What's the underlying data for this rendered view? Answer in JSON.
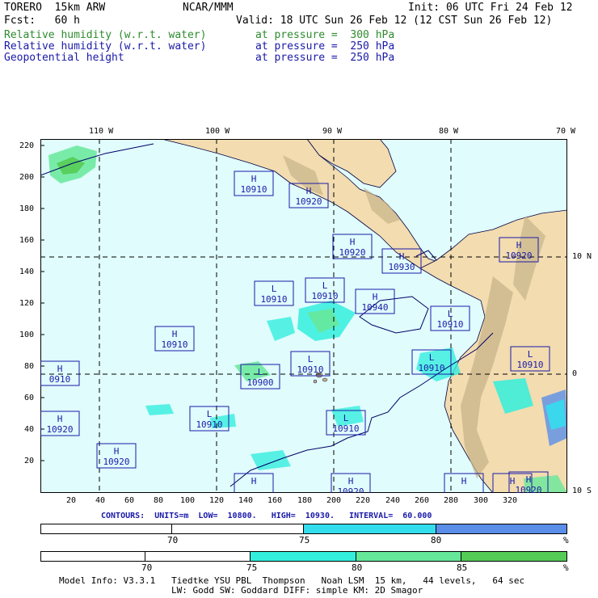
{
  "header": {
    "model": "TORERO  15km ARW",
    "org": "NCAR/MMM",
    "init": "Init: 06 UTC Fri 24 Feb 12",
    "fcst": "Fcst:   60 h",
    "valid": "Valid: 18 UTC Sun 26 Feb 12 (12 CST Sun 26 Feb 12)",
    "fields": [
      {
        "name": "Relative humidity (w.r.t. water)",
        "level": "at pressure =  300 hPa",
        "color": "#2e8b2e"
      },
      {
        "name": "Relative humidity (w.r.t. water)",
        "level": "at pressure =  250 hPa",
        "color": "#1a1aa8"
      },
      {
        "name": "Geopotential height",
        "level": "at pressure =  250 hPa",
        "color": "#1a1aa8"
      }
    ]
  },
  "map": {
    "top_longitudes": [
      "110 W",
      "100 W",
      "90 W",
      "80 W",
      "70 W"
    ],
    "right_latitudes": [
      "10 N",
      "0",
      "10 S"
    ],
    "left_ticks": [
      "220",
      "200",
      "180",
      "160",
      "140",
      "120",
      "100",
      "80",
      "60",
      "40",
      "20"
    ],
    "bottom_ticks": [
      "20",
      "40",
      "60",
      "80",
      "100",
      "120",
      "140",
      "160",
      "180",
      "200",
      "220",
      "240",
      "260",
      "280",
      "300",
      "320"
    ],
    "ocean_color": "#e0fcfc",
    "land_color": "#f2dcb0",
    "centers": [
      {
        "type": "H",
        "value": "10910"
      },
      {
        "type": "H",
        "value": "10920"
      },
      {
        "type": "H",
        "value": "10920"
      },
      {
        "type": "H",
        "value": "10930"
      },
      {
        "type": "H",
        "value": "10920"
      },
      {
        "type": "L",
        "value": "10910"
      },
      {
        "type": "L",
        "value": "10910"
      },
      {
        "type": "H",
        "value": "10940"
      },
      {
        "type": "L",
        "value": "10910"
      },
      {
        "type": "H",
        "value": "10910"
      },
      {
        "type": "L",
        "value": "10910"
      },
      {
        "type": "L",
        "value": "10910"
      },
      {
        "type": "L",
        "value": "10910"
      },
      {
        "type": "H",
        "value": "0910"
      },
      {
        "type": "L",
        "value": "10900"
      },
      {
        "type": "H",
        "value": "10920"
      },
      {
        "type": "L",
        "value": "10910"
      },
      {
        "type": "L",
        "value": "10910"
      },
      {
        "type": "H",
        "value": "10920"
      },
      {
        "type": "H",
        "value": "10920"
      },
      {
        "type": "H",
        "value": "10920"
      },
      {
        "type": "H",
        "value": ""
      },
      {
        "type": "H",
        "value": ""
      },
      {
        "type": "H",
        "value": ""
      }
    ]
  },
  "contours": "CONTOURS:  UNITS=m  LOW=  10800.   HIGH=  10930.   INTERVAL=  60.000",
  "legend_250": {
    "labels": [
      "70",
      "75",
      "80"
    ],
    "unit": "%",
    "colors": [
      "#ffffff",
      "#ffffff",
      "#33ddee",
      "#5a8ee8"
    ]
  },
  "legend_300": {
    "labels": [
      "70",
      "75",
      "80",
      "85"
    ],
    "unit": "%",
    "colors": [
      "#ffffff",
      "#ffffff",
      "#33eedd",
      "#66e89a",
      "#55cc55"
    ]
  },
  "footer": {
    "line1": "Model Info: V3.3.1   Tiedtke YSU PBL  Thompson   Noah LSM  15 km,   44 levels,   64 sec",
    "line2": "LW: Godd SW: Goddard DIFF: simple KM: 2D Smagor"
  }
}
